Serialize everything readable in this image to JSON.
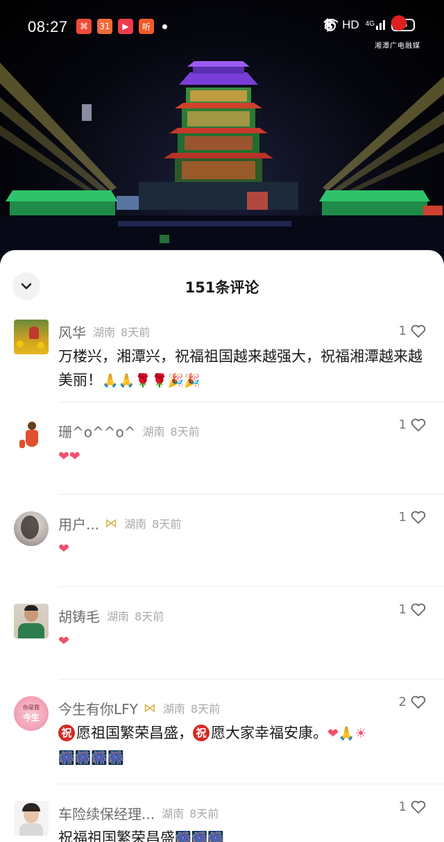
{
  "status_bar": {
    "time": "08:27",
    "app_badges": [
      {
        "icon": "orange-app-icon",
        "glyph": "⌘",
        "color": "#f04b3a"
      },
      {
        "icon": "calendar-31-icon",
        "glyph": "31",
        "color": "#f06a3a"
      },
      {
        "icon": "video-play-icon",
        "glyph": "▶",
        "color": "#f03a4a"
      },
      {
        "icon": "listen-app-icon",
        "glyph": "听",
        "color": "#f05a2a"
      }
    ],
    "network": "HD",
    "signal": "4G",
    "battery": "75"
  },
  "video": {
    "watermark": "湘潭广电融媒"
  },
  "comments_panel": {
    "title": "151条评论",
    "comments": [
      {
        "user": "风华",
        "location": "湖南",
        "time": "8天前",
        "likes": "1",
        "text": "万楼兴，湘潭兴，祝福祖国越来越强大，祝福湘潭越来越美丽！",
        "emojis": "🙏🙏🌹🌹🎉🎉"
      },
      {
        "user": "珊^o^^o^",
        "location": "湖南",
        "time": "8天前",
        "likes": "1",
        "emojis": "❤❤"
      },
      {
        "user": "用户...",
        "location": "湖南",
        "time": "8天前",
        "likes": "1",
        "emojis": "❤"
      },
      {
        "user": "胡铸毛",
        "location": "湖南",
        "time": "8天前",
        "likes": "1",
        "emojis": "❤"
      },
      {
        "user": "今生有你LFY",
        "location": "湖南",
        "time": "8天前",
        "likes": "2",
        "fortune_glyph": "祝",
        "text_a": "愿祖国繁荣昌盛，",
        "text_b": "愿大家幸福安康。",
        "emojis_end": "❤🙏☀",
        "emojis_line2": "🎆🎆🎆🎆",
        "avatar_top": "你是我",
        "avatar_main": "今生"
      },
      {
        "user": "车险续保经理...",
        "location": "湖南",
        "time": "8天前",
        "likes": "1",
        "text": "祝福祖国繁荣昌盛",
        "emojis": "🎆🎆🎆"
      }
    ]
  }
}
